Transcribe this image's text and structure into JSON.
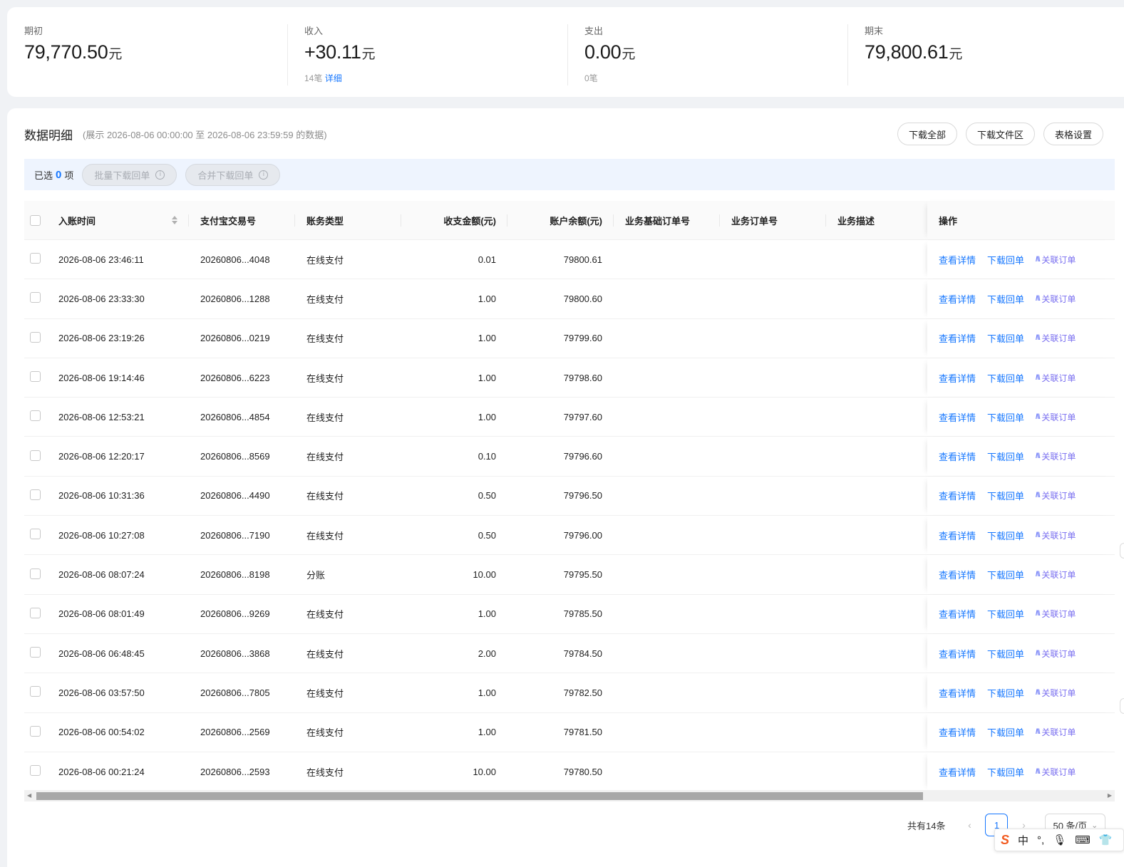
{
  "summary": [
    {
      "label": "期初",
      "value": "79,770.50",
      "unit": "元",
      "sub_count": "",
      "sub_link": ""
    },
    {
      "label": "收入",
      "value": "+30.11",
      "unit": "元",
      "sub_count": "14笔",
      "sub_link": "详细"
    },
    {
      "label": "支出",
      "value": "0.00",
      "unit": "元",
      "sub_count": "0笔",
      "sub_link": ""
    },
    {
      "label": "期末",
      "value": "79,800.61",
      "unit": "元",
      "sub_count": "",
      "sub_link": ""
    }
  ],
  "panel": {
    "title": "数据明细",
    "range": "(展示 2026-08-06 00:00:00 至 2026-08-06 23:59:59 的数据)",
    "buttons": [
      "下载全部",
      "下载文件区",
      "表格设置"
    ]
  },
  "selection": {
    "prefix": "已选",
    "count": "0",
    "suffix": "项",
    "batch_download": "批量下载回单",
    "merge_download": "合并下载回单",
    "info_glyph": "i"
  },
  "table": {
    "headers": {
      "time": "入账时间",
      "txn": "支付宝交易号",
      "type": "账务类型",
      "amount": "收支金额(元)",
      "balance": "账户余额(元)",
      "biz_base_order": "业务基础订单号",
      "biz_order": "业务订单号",
      "desc": "业务描述",
      "ops": "操作"
    },
    "ops_labels": {
      "detail": "查看详情",
      "receipt": "下载回单",
      "link_order": "关联订单",
      "ai_glyph": "/\\\\"
    },
    "rows": [
      {
        "time": "2026-08-06 23:46:11",
        "txn": "20260806...4048",
        "type": "在线支付",
        "amount": "0.01",
        "balance": "79800.61"
      },
      {
        "time": "2026-08-06 23:33:30",
        "txn": "20260806...1288",
        "type": "在线支付",
        "amount": "1.00",
        "balance": "79800.60"
      },
      {
        "time": "2026-08-06 23:19:26",
        "txn": "20260806...0219",
        "type": "在线支付",
        "amount": "1.00",
        "balance": "79799.60"
      },
      {
        "time": "2026-08-06 19:14:46",
        "txn": "20260806...6223",
        "type": "在线支付",
        "amount": "1.00",
        "balance": "79798.60"
      },
      {
        "time": "2026-08-06 12:53:21",
        "txn": "20260806...4854",
        "type": "在线支付",
        "amount": "1.00",
        "balance": "79797.60"
      },
      {
        "time": "2026-08-06 12:20:17",
        "txn": "20260806...8569",
        "type": "在线支付",
        "amount": "0.10",
        "balance": "79796.60"
      },
      {
        "time": "2026-08-06 10:31:36",
        "txn": "20260806...4490",
        "type": "在线支付",
        "amount": "0.50",
        "balance": "79796.50"
      },
      {
        "time": "2026-08-06 10:27:08",
        "txn": "20260806...7190",
        "type": "在线支付",
        "amount": "0.50",
        "balance": "79796.00"
      },
      {
        "time": "2026-08-06 08:07:24",
        "txn": "20260806...8198",
        "type": "分账",
        "amount": "10.00",
        "balance": "79795.50"
      },
      {
        "time": "2026-08-06 08:01:49",
        "txn": "20260806...9269",
        "type": "在线支付",
        "amount": "1.00",
        "balance": "79785.50"
      },
      {
        "time": "2026-08-06 06:48:45",
        "txn": "20260806...3868",
        "type": "在线支付",
        "amount": "2.00",
        "balance": "79784.50"
      },
      {
        "time": "2026-08-06 03:57:50",
        "txn": "20260806...7805",
        "type": "在线支付",
        "amount": "1.00",
        "balance": "79782.50"
      },
      {
        "time": "2026-08-06 00:54:02",
        "txn": "20260806...2569",
        "type": "在线支付",
        "amount": "1.00",
        "balance": "79781.50"
      },
      {
        "time": "2026-08-06 00:21:24",
        "txn": "20260806...2593",
        "type": "在线支付",
        "amount": "10.00",
        "balance": "79780.50"
      }
    ]
  },
  "pagination": {
    "total": "共有14条",
    "prev": "‹",
    "current": "1",
    "next": "›",
    "page_size": "50 条/页",
    "size_arrow": "⌄"
  },
  "ime": {
    "logo": "S",
    "mode": "中",
    "punct": "°,",
    "mic": "🎙",
    "keyboard": "⌨",
    "shirt": "👕"
  },
  "colors": {
    "accent": "#1677ff",
    "ai_purple": "#7a6ff0",
    "selection_bg": "#eef4fe"
  }
}
